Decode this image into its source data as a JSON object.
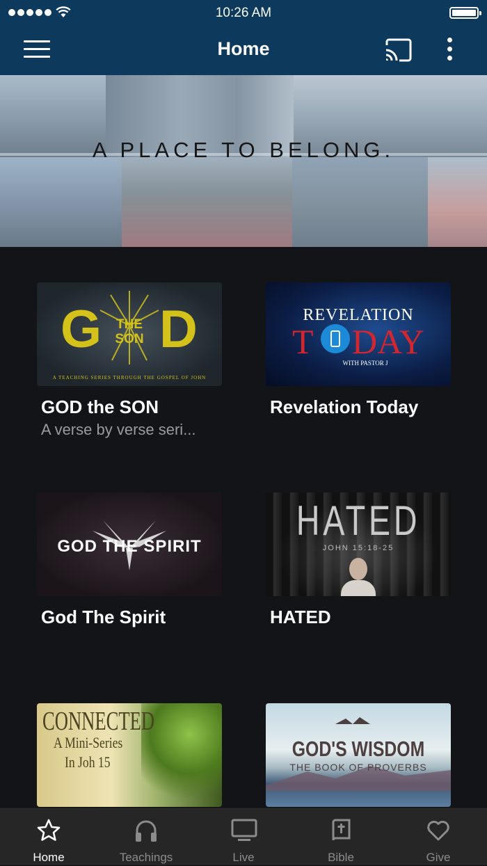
{
  "status_bar": {
    "time": "10:26 AM"
  },
  "nav": {
    "title": "Home"
  },
  "hero": {
    "text": "A PLACE TO BELONG."
  },
  "cards": [
    {
      "title": "GOD the SON",
      "subtitle": "A verse by verse seri...",
      "art": {
        "big_left": "G",
        "big_right": "D",
        "center_top": "THE",
        "center_bottom": "SON",
        "caption": "A TEACHING SERIES THROUGH THE GOSPEL OF JOHN"
      }
    },
    {
      "title": "Revelation Today",
      "subtitle": "",
      "art": {
        "line1": "REVELATION",
        "line2_left": "T",
        "line2_right": "DAY",
        "caption": "WITH PASTOR J"
      }
    },
    {
      "title": "God The Spirit",
      "subtitle": "",
      "art": {
        "text": "GOD THE SPIRIT"
      }
    },
    {
      "title": "HATED",
      "subtitle": "",
      "art": {
        "text": "HATED",
        "caption": "JOHN 15:18-25"
      }
    },
    {
      "title": "",
      "subtitle": "",
      "art": {
        "line1": "CONNECTED",
        "line2": "A Mini-Series",
        "line3": "In Joh 15"
      }
    },
    {
      "title": "",
      "subtitle": "",
      "art": {
        "line1": "GOD'S WISDOM",
        "line2": "THE BOOK OF PROVERBS"
      }
    }
  ],
  "tabs": [
    {
      "label": "Home",
      "icon": "star-icon",
      "active": true
    },
    {
      "label": "Teachings",
      "icon": "headphones-icon",
      "active": false
    },
    {
      "label": "Live",
      "icon": "tv-icon",
      "active": false
    },
    {
      "label": "Bible",
      "icon": "bible-icon",
      "active": false
    },
    {
      "label": "Give",
      "icon": "heart-icon",
      "active": false
    }
  ],
  "colors": {
    "nav_bg": "#0d3a5c",
    "page_bg": "#131418",
    "tabbar_bg": "#262626",
    "active_tab": "#ffffff",
    "inactive_tab": "#8c8c8c",
    "subtitle": "#9a9b9f"
  }
}
